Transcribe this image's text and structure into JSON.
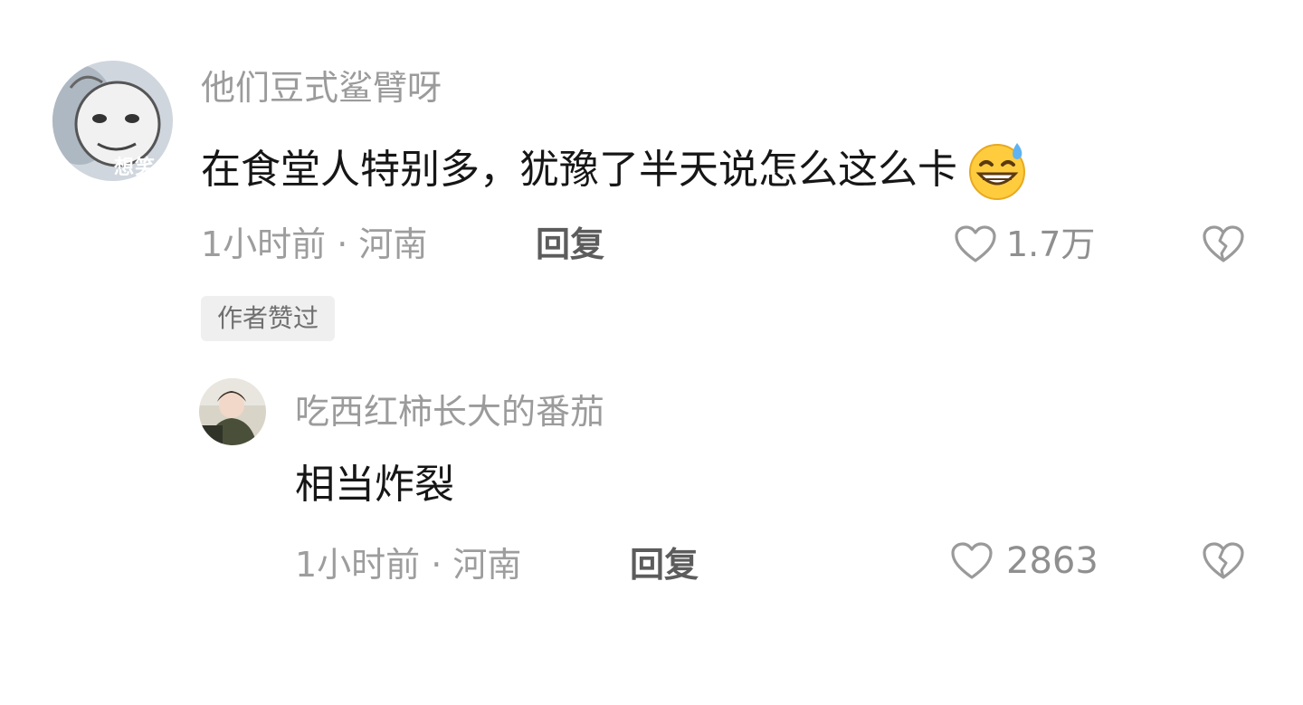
{
  "comment": {
    "username": "他们豆式鲨臂呀",
    "avatar_overlay_text": "想笑",
    "text": "在食堂人特别多，犹豫了半天说怎么这么卡",
    "emoji": "grinning-sweat-emoji",
    "time_location": "1小时前 · 河南",
    "reply_label": "回复",
    "like_count": "1.7万",
    "author_badge": "作者赞过"
  },
  "reply": {
    "username": "吃西红柿长大的番茄",
    "text": "相当炸裂",
    "time_location": "1小时前 · 河南",
    "reply_label": "回复",
    "like_count": "2863"
  },
  "icons": {
    "like": "heart-outline-icon",
    "dislike": "broken-heart-icon"
  },
  "colors": {
    "secondary_text": "#9b9b9b",
    "primary_text": "#161616",
    "badge_bg": "#efefef"
  }
}
